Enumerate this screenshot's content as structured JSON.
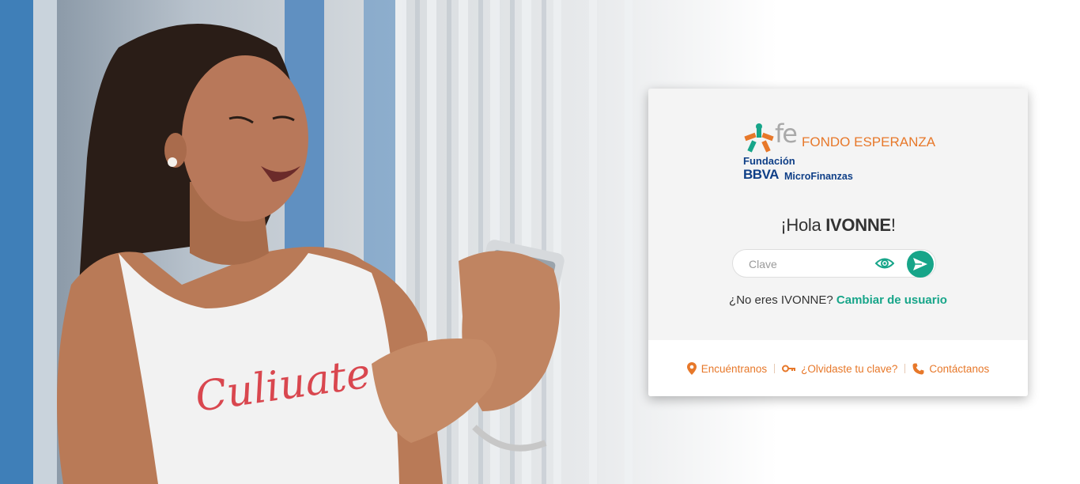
{
  "brand": {
    "mark_text": "fe",
    "name": "FONDO ESPERANZA",
    "fundacion": "Fundación",
    "bbva": "BBVA",
    "microfinanzas": "MicroFinanzas",
    "colors": {
      "orange": "#e7782a",
      "teal": "#17a589",
      "navy": "#0f3f87",
      "gray": "#a9a9a9"
    }
  },
  "login": {
    "greeting_prefix": "¡Hola ",
    "user_name": "IVONNE",
    "greeting_suffix": "!",
    "password_placeholder": "Clave",
    "password_value": "",
    "show_password_icon": "eye-icon",
    "submit_icon": "send-icon",
    "not_you_prefix": "¿No eres IVONNE? ",
    "change_user_label": "Cambiar de usuario"
  },
  "footer": {
    "links": [
      {
        "label": "Encuéntranos",
        "icon": "location-pin-icon"
      },
      {
        "label": "¿Olvidaste tu clave?",
        "icon": "key-icon"
      },
      {
        "label": "Contáctanos",
        "icon": "phone-icon"
      }
    ]
  }
}
